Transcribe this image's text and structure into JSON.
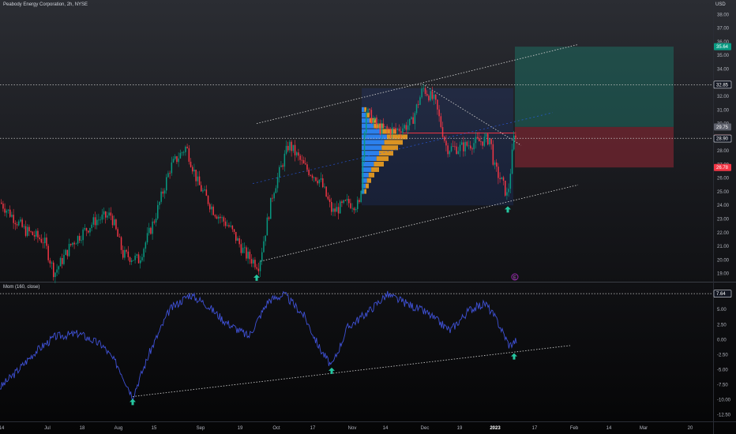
{
  "header": {
    "title": "Peabody Energy Corporation, 2h, NYSE",
    "currency": "USD"
  },
  "price_axis": {
    "ticks": [
      "38.00",
      "37.00",
      "36.00",
      "35.00",
      "34.00",
      "33.00",
      "32.00",
      "31.00",
      "30.00",
      "29.00",
      "28.00",
      "27.00",
      "26.00",
      "25.00",
      "24.00",
      "23.00",
      "22.00",
      "21.00",
      "20.00",
      "19.00"
    ],
    "badges": [
      {
        "label": "35.64",
        "value": 35.64,
        "color": "#089981"
      },
      {
        "label": "32.85",
        "value": 32.85,
        "color": "#131722"
      },
      {
        "label": "29.75",
        "value": 29.75,
        "color": "#5d606b"
      },
      {
        "label": "28.92",
        "value": 28.92,
        "color": "#f23645"
      },
      {
        "label": "28.90",
        "value": 28.9,
        "color": "#131722"
      },
      {
        "label": "26.78",
        "value": 26.78,
        "color": "#f23645"
      }
    ]
  },
  "indicator": {
    "title": "Mom (160, close)",
    "ticks": [
      "7.50",
      "5.00",
      "2.50",
      "0.00",
      "-2.50",
      "-5.00",
      "-7.50",
      "-10.00",
      "-12.50"
    ],
    "badge": {
      "label": "7.64",
      "value": 7.64
    }
  },
  "time_axis": [
    "14",
    "Jul",
    "18",
    "Aug",
    "15",
    "Sep",
    "19",
    "Oct",
    "17",
    "Nov",
    "14",
    "Dec",
    "19",
    "2023",
    "17",
    "Feb",
    "14",
    "Mar",
    "20"
  ],
  "markers": {
    "earnings_symbol": "E"
  },
  "colors": {
    "up": "#089981",
    "down": "#f23645",
    "momentum": "#3f51d6",
    "target_zone": "#1e6b60",
    "stop_zone": "#7a2530"
  },
  "chart_data": [
    {
      "type": "candlestick",
      "title": "Peabody Energy Corporation, 2h, NYSE",
      "ylim": [
        18.4,
        38.6
      ],
      "x_labels": [
        "14",
        "Jul",
        "18",
        "Aug",
        "15",
        "Sep",
        "19",
        "Oct",
        "17",
        "Nov",
        "14",
        "Dec",
        "19",
        "2023",
        "17",
        "Feb",
        "14",
        "Mar",
        "20"
      ],
      "price_path": [
        [
          0,
          24.2
        ],
        [
          30,
          22.2
        ],
        [
          55,
          21.4
        ],
        [
          68,
          19.0
        ],
        [
          90,
          21.2
        ],
        [
          120,
          22.9
        ],
        [
          140,
          23.3
        ],
        [
          155,
          20.4
        ],
        [
          175,
          20.0
        ],
        [
          195,
          23.0
        ],
        [
          215,
          26.8
        ],
        [
          235,
          28.3
        ],
        [
          250,
          25.6
        ],
        [
          270,
          23.6
        ],
        [
          290,
          22.4
        ],
        [
          310,
          20.4
        ],
        [
          327,
          19.6
        ],
        [
          345,
          25.0
        ],
        [
          365,
          28.5
        ],
        [
          385,
          26.8
        ],
        [
          405,
          25.8
        ],
        [
          420,
          23.5
        ],
        [
          440,
          24.2
        ],
        [
          455,
          24.0
        ],
        [
          462,
          31.0
        ],
        [
          480,
          29.6
        ],
        [
          500,
          29.5
        ],
        [
          520,
          30.0
        ],
        [
          535,
          32.6
        ],
        [
          550,
          31.6
        ],
        [
          565,
          28.2
        ],
        [
          580,
          28.2
        ],
        [
          600,
          28.6
        ],
        [
          620,
          28.9
        ],
        [
          625,
          26.8
        ],
        [
          635,
          25.7
        ],
        [
          642,
          24.6
        ],
        [
          650,
          28.9
        ],
        [
          654,
          29.6
        ]
      ],
      "horizontal_levels": [
        32.85,
        28.92
      ],
      "long_position": {
        "target": 35.64,
        "entry": 29.75,
        "stop": 26.78
      },
      "channel": {
        "upper_start": 30.0,
        "upper_end": 35.8,
        "lower_start": 19.9,
        "lower_end": 25.5
      },
      "signal_arrows_at": [
        19.3,
        19.3,
        24.0
      ]
    },
    {
      "type": "line",
      "title": "Mom (160, close)",
      "ylim": [
        -13.5,
        9.5
      ],
      "series": [
        {
          "values": [
            [
              0,
              -8.0
            ],
            [
              20,
              -5.5
            ],
            [
              45,
              -2.0
            ],
            [
              70,
              0.5
            ],
            [
              100,
              1.0
            ],
            [
              130,
              -1.0
            ],
            [
              150,
              -4.5
            ],
            [
              168,
              -9.5
            ],
            [
              190,
              -2.0
            ],
            [
              215,
              5.0
            ],
            [
              240,
              7.5
            ],
            [
              260,
              6.0
            ],
            [
              285,
              3.0
            ],
            [
              315,
              0.5
            ],
            [
              340,
              6.5
            ],
            [
              360,
              7.5
            ],
            [
              385,
              4.0
            ],
            [
              405,
              -1.5
            ],
            [
              420,
              -4.5
            ],
            [
              440,
              2.0
            ],
            [
              465,
              4.5
            ],
            [
              490,
              7.5
            ],
            [
              515,
              6.0
            ],
            [
              540,
              4.5
            ],
            [
              570,
              1.5
            ],
            [
              595,
              5.0
            ],
            [
              615,
              6.0
            ],
            [
              630,
              3.0
            ],
            [
              645,
              -1.0
            ],
            [
              655,
              0.0
            ]
          ]
        }
      ],
      "trendline": [
        -9.5,
        -1.0
      ],
      "level": 7.64
    }
  ]
}
